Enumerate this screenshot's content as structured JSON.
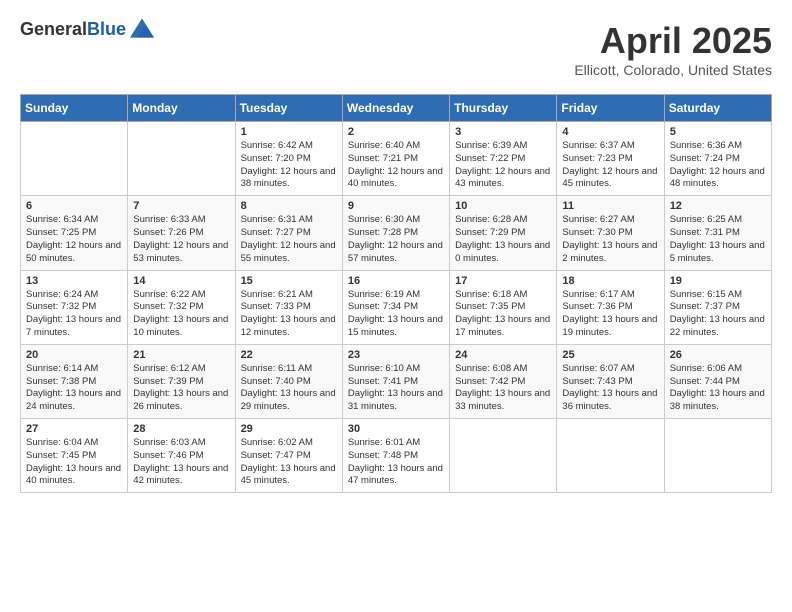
{
  "header": {
    "logo_general": "General",
    "logo_blue": "Blue",
    "month_title": "April 2025",
    "location": "Ellicott, Colorado, United States"
  },
  "days_of_week": [
    "Sunday",
    "Monday",
    "Tuesday",
    "Wednesday",
    "Thursday",
    "Friday",
    "Saturday"
  ],
  "weeks": [
    [
      {
        "day": "",
        "info": ""
      },
      {
        "day": "",
        "info": ""
      },
      {
        "day": "1",
        "info": "Sunrise: 6:42 AM\nSunset: 7:20 PM\nDaylight: 12 hours and 38 minutes."
      },
      {
        "day": "2",
        "info": "Sunrise: 6:40 AM\nSunset: 7:21 PM\nDaylight: 12 hours and 40 minutes."
      },
      {
        "day": "3",
        "info": "Sunrise: 6:39 AM\nSunset: 7:22 PM\nDaylight: 12 hours and 43 minutes."
      },
      {
        "day": "4",
        "info": "Sunrise: 6:37 AM\nSunset: 7:23 PM\nDaylight: 12 hours and 45 minutes."
      },
      {
        "day": "5",
        "info": "Sunrise: 6:36 AM\nSunset: 7:24 PM\nDaylight: 12 hours and 48 minutes."
      }
    ],
    [
      {
        "day": "6",
        "info": "Sunrise: 6:34 AM\nSunset: 7:25 PM\nDaylight: 12 hours and 50 minutes."
      },
      {
        "day": "7",
        "info": "Sunrise: 6:33 AM\nSunset: 7:26 PM\nDaylight: 12 hours and 53 minutes."
      },
      {
        "day": "8",
        "info": "Sunrise: 6:31 AM\nSunset: 7:27 PM\nDaylight: 12 hours and 55 minutes."
      },
      {
        "day": "9",
        "info": "Sunrise: 6:30 AM\nSunset: 7:28 PM\nDaylight: 12 hours and 57 minutes."
      },
      {
        "day": "10",
        "info": "Sunrise: 6:28 AM\nSunset: 7:29 PM\nDaylight: 13 hours and 0 minutes."
      },
      {
        "day": "11",
        "info": "Sunrise: 6:27 AM\nSunset: 7:30 PM\nDaylight: 13 hours and 2 minutes."
      },
      {
        "day": "12",
        "info": "Sunrise: 6:25 AM\nSunset: 7:31 PM\nDaylight: 13 hours and 5 minutes."
      }
    ],
    [
      {
        "day": "13",
        "info": "Sunrise: 6:24 AM\nSunset: 7:32 PM\nDaylight: 13 hours and 7 minutes."
      },
      {
        "day": "14",
        "info": "Sunrise: 6:22 AM\nSunset: 7:32 PM\nDaylight: 13 hours and 10 minutes."
      },
      {
        "day": "15",
        "info": "Sunrise: 6:21 AM\nSunset: 7:33 PM\nDaylight: 13 hours and 12 minutes."
      },
      {
        "day": "16",
        "info": "Sunrise: 6:19 AM\nSunset: 7:34 PM\nDaylight: 13 hours and 15 minutes."
      },
      {
        "day": "17",
        "info": "Sunrise: 6:18 AM\nSunset: 7:35 PM\nDaylight: 13 hours and 17 minutes."
      },
      {
        "day": "18",
        "info": "Sunrise: 6:17 AM\nSunset: 7:36 PM\nDaylight: 13 hours and 19 minutes."
      },
      {
        "day": "19",
        "info": "Sunrise: 6:15 AM\nSunset: 7:37 PM\nDaylight: 13 hours and 22 minutes."
      }
    ],
    [
      {
        "day": "20",
        "info": "Sunrise: 6:14 AM\nSunset: 7:38 PM\nDaylight: 13 hours and 24 minutes."
      },
      {
        "day": "21",
        "info": "Sunrise: 6:12 AM\nSunset: 7:39 PM\nDaylight: 13 hours and 26 minutes."
      },
      {
        "day": "22",
        "info": "Sunrise: 6:11 AM\nSunset: 7:40 PM\nDaylight: 13 hours and 29 minutes."
      },
      {
        "day": "23",
        "info": "Sunrise: 6:10 AM\nSunset: 7:41 PM\nDaylight: 13 hours and 31 minutes."
      },
      {
        "day": "24",
        "info": "Sunrise: 6:08 AM\nSunset: 7:42 PM\nDaylight: 13 hours and 33 minutes."
      },
      {
        "day": "25",
        "info": "Sunrise: 6:07 AM\nSunset: 7:43 PM\nDaylight: 13 hours and 36 minutes."
      },
      {
        "day": "26",
        "info": "Sunrise: 6:06 AM\nSunset: 7:44 PM\nDaylight: 13 hours and 38 minutes."
      }
    ],
    [
      {
        "day": "27",
        "info": "Sunrise: 6:04 AM\nSunset: 7:45 PM\nDaylight: 13 hours and 40 minutes."
      },
      {
        "day": "28",
        "info": "Sunrise: 6:03 AM\nSunset: 7:46 PM\nDaylight: 13 hours and 42 minutes."
      },
      {
        "day": "29",
        "info": "Sunrise: 6:02 AM\nSunset: 7:47 PM\nDaylight: 13 hours and 45 minutes."
      },
      {
        "day": "30",
        "info": "Sunrise: 6:01 AM\nSunset: 7:48 PM\nDaylight: 13 hours and 47 minutes."
      },
      {
        "day": "",
        "info": ""
      },
      {
        "day": "",
        "info": ""
      },
      {
        "day": "",
        "info": ""
      }
    ]
  ]
}
